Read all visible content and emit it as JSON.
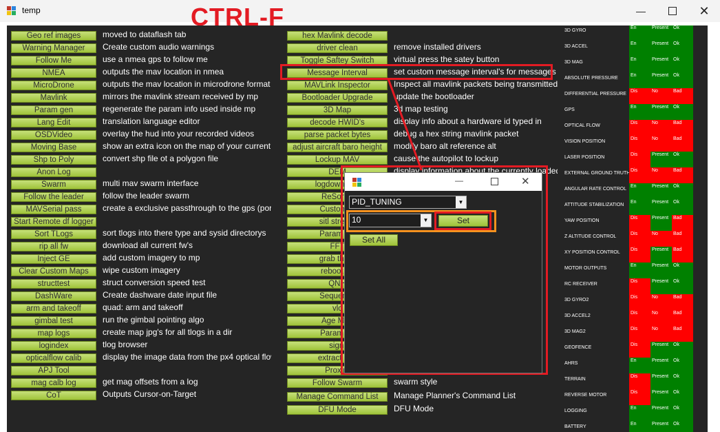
{
  "window": {
    "title": "temp"
  },
  "annotation": {
    "shortcut": "CTRL-F"
  },
  "tools_left": [
    {
      "label": "Geo ref images",
      "desc": "moved to dataflash tab"
    },
    {
      "label": "Warning Manager",
      "desc": "Create custom audio warnings"
    },
    {
      "label": "Follow Me",
      "desc": "use a nmea gps to follow me"
    },
    {
      "label": "NMEA",
      "desc": "outputs the mav location in nmea"
    },
    {
      "label": "MicroDrone",
      "desc": "outputs the mav location in microdrone format"
    },
    {
      "label": "Mavlink",
      "desc": "mirrors the mavlink stream received by mp"
    },
    {
      "label": "Param gen",
      "desc": "regenerate the param info used inside mp"
    },
    {
      "label": "Lang Edit",
      "desc": "translation language editor"
    },
    {
      "label": "OSDVideo",
      "desc": "overlay the hud into your recorded videos"
    },
    {
      "label": "Moving Base",
      "desc": "show an extra icon on the map of your current"
    },
    {
      "label": "Shp to Poly",
      "desc": "convert shp file ot a polygon file"
    },
    {
      "label": "Anon Log",
      "desc": ""
    },
    {
      "label": "Swarm",
      "desc": "multi mav swarm interface"
    },
    {
      "label": "Follow the leader",
      "desc": "follow the leader swarm"
    },
    {
      "label": "MAVSerial pass",
      "desc": "create a exclusive passthrough to the gps (port"
    },
    {
      "label": "Start Remote df logger",
      "desc": ""
    },
    {
      "label": "Sort TLogs",
      "desc": "sort tlogs into there type and sysid directorys"
    },
    {
      "label": "rip all fw",
      "desc": "download all current fw's"
    },
    {
      "label": "Inject GE",
      "desc": "add custom imagery to mp"
    },
    {
      "label": "Clear Custom Maps",
      "desc": "wipe custom imagery"
    },
    {
      "label": "structtest",
      "desc": "struct conversion speed test"
    },
    {
      "label": "DashWare",
      "desc": "Create dashware date input file"
    },
    {
      "label": "arm and takeoff",
      "desc": "quad: arm and takeoff"
    },
    {
      "label": "gimbal test",
      "desc": "run the gimbal pointing algo"
    },
    {
      "label": "map logs",
      "desc": "create map jpg's for all tlogs in a dir"
    },
    {
      "label": "logindex",
      "desc": "tlog browser"
    },
    {
      "label": "opticalflow calib",
      "desc": "display the image data from the px4 optical flow"
    },
    {
      "label": "APJ Tool",
      "desc": ""
    },
    {
      "label": "mag calb log",
      "desc": "get mag offsets from a log"
    },
    {
      "label": "CoT",
      "desc": "Outputs Cursor-on-Target"
    }
  ],
  "tools_mid": [
    {
      "label": "hex Mavlink decode",
      "desc": ""
    },
    {
      "label": "driver clean",
      "desc": "remove installed drivers"
    },
    {
      "label": "Toggle Saftey Switch",
      "desc": "virtual press the satey button"
    },
    {
      "label": "Message Interval",
      "desc": "set custom message interval's for messages"
    },
    {
      "label": "MAVLink Inspector",
      "desc": "Inspect all mavlink packets being transmitted"
    },
    {
      "label": "Bootloader Upgrade",
      "desc": "update the bootloader"
    },
    {
      "label": "3D Map",
      "desc": "3d map testing"
    },
    {
      "label": "decode HWID's",
      "desc": "display info about a hardware id typed in"
    },
    {
      "label": "parse packet bytes",
      "desc": "debug a hex string mavlink packet"
    },
    {
      "label": "adjust aircraft baro height",
      "desc": "modify baro alt reference alt"
    },
    {
      "label": "Lockup MAV",
      "desc": "cause the autopilot to lockup"
    },
    {
      "label": "DEM",
      "desc": "display information about the currently loaded"
    },
    {
      "label": "logdownload",
      "desc": ""
    },
    {
      "label": "ReSort A",
      "desc": ""
    },
    {
      "label": "Custom C",
      "desc": ""
    },
    {
      "label": "sitl stream",
      "desc": ""
    },
    {
      "label": "Param Re",
      "desc": ""
    },
    {
      "label": "FFT",
      "desc": ""
    },
    {
      "label": "grab threa",
      "desc": ""
    },
    {
      "label": "reboot pc",
      "desc": ""
    },
    {
      "label": "QNH",
      "desc": ""
    },
    {
      "label": "Sequence",
      "desc": ""
    },
    {
      "label": "vlc",
      "desc": ""
    },
    {
      "label": "Age Map",
      "desc": ""
    },
    {
      "label": "Param ge",
      "desc": ""
    },
    {
      "label": "signi",
      "desc": ""
    },
    {
      "label": "extract gps",
      "desc": ""
    },
    {
      "label": "Proxim",
      "desc": ""
    },
    {
      "label": "Follow Swarm",
      "desc": "swarm style"
    },
    {
      "label": "Manage Command List",
      "desc": "Manage Planner's Command List"
    },
    {
      "label": "DFU Mode",
      "desc": "DFU Mode"
    }
  ],
  "sensors": [
    {
      "name": "3D GYRO",
      "en": "En",
      "present": "Present",
      "health": "Ok"
    },
    {
      "name": "3D ACCEL",
      "en": "En",
      "present": "Present",
      "health": "Ok"
    },
    {
      "name": "3D MAG",
      "en": "En",
      "present": "Present",
      "health": "Ok"
    },
    {
      "name": "ABSOLUTE PRESSURE",
      "en": "En",
      "present": "Present",
      "health": "Ok"
    },
    {
      "name": "DIFFERENTIAL PRESSURE",
      "en": "Dis",
      "present": "No",
      "health": "Bad"
    },
    {
      "name": "GPS",
      "en": "En",
      "present": "Present",
      "health": "Ok"
    },
    {
      "name": "OPTICAL FLOW",
      "en": "Dis",
      "present": "No",
      "health": "Bad"
    },
    {
      "name": "VISION POSITION",
      "en": "Dis",
      "present": "No",
      "health": "Bad"
    },
    {
      "name": "LASER POSITION",
      "en": "Dis",
      "present": "Present",
      "health": "Ok"
    },
    {
      "name": "EXTERNAL GROUND TRUTH",
      "en": "Dis",
      "present": "No",
      "health": "Bad"
    },
    {
      "name": "ANGULAR RATE CONTROL",
      "en": "En",
      "present": "Present",
      "health": "Ok"
    },
    {
      "name": "ATTITUDE STABILIZATION",
      "en": "En",
      "present": "Present",
      "health": "Ok"
    },
    {
      "name": "YAW POSITION",
      "en": "Dis",
      "present": "Present",
      "health": "Bad"
    },
    {
      "name": "Z ALTITUDE CONTROL",
      "en": "Dis",
      "present": "No",
      "health": "Bad"
    },
    {
      "name": "XY POSITION CONTROL",
      "en": "Dis",
      "present": "Present",
      "health": "Bad"
    },
    {
      "name": "MOTOR OUTPUTS",
      "en": "En",
      "present": "Present",
      "health": "Ok"
    },
    {
      "name": "RC RECEIVER",
      "en": "Dis",
      "present": "Present",
      "health": "Ok"
    },
    {
      "name": "3D GYRO2",
      "en": "Dis",
      "present": "No",
      "health": "Bad"
    },
    {
      "name": "3D ACCEL2",
      "en": "Dis",
      "present": "No",
      "health": "Bad"
    },
    {
      "name": "3D MAG2",
      "en": "Dis",
      "present": "No",
      "health": "Bad"
    },
    {
      "name": "GEOFENCE",
      "en": "Dis",
      "present": "Present",
      "health": "Ok"
    },
    {
      "name": "AHRS",
      "en": "En",
      "present": "Present",
      "health": "Ok"
    },
    {
      "name": "TERRAIN",
      "en": "Dis",
      "present": "Present",
      "health": "Ok"
    },
    {
      "name": "REVERSE MOTOR",
      "en": "Dis",
      "present": "Present",
      "health": "Ok"
    },
    {
      "name": "LOGGING",
      "en": "En",
      "present": "Present",
      "health": "Ok"
    },
    {
      "name": "BATTERY",
      "en": "En",
      "present": "Present",
      "health": "Ok"
    }
  ],
  "dialog": {
    "param_combo": "PID_TUNING",
    "rate_combo": "10",
    "set_label": "Set",
    "set_all_label": "Set All"
  },
  "colors": {
    "ok_green": "#008000",
    "bad_red": "#ff0000",
    "annotation_red": "#e31b23",
    "annotation_orange": "#f7921e",
    "button_green": "#b5d35a"
  }
}
